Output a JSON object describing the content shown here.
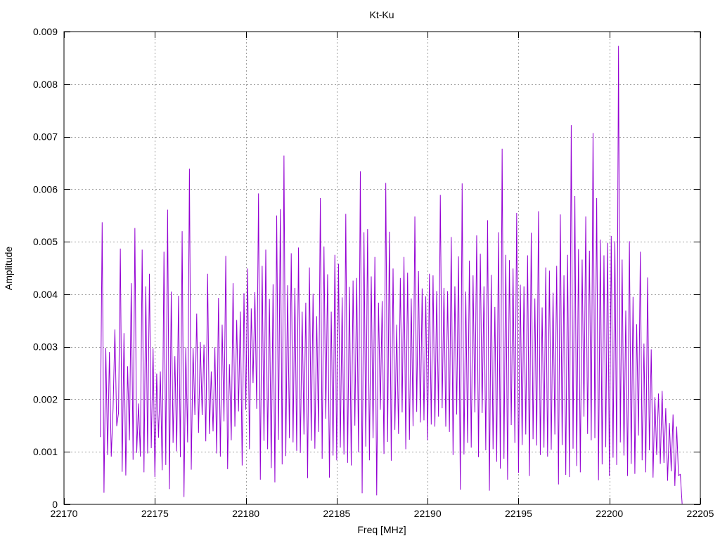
{
  "chart_data": {
    "type": "line",
    "title": "Kt-Ku",
    "xlabel": "Freq [MHz]",
    "ylabel": "Amplitude",
    "xlim": [
      22170,
      22205
    ],
    "ylim": [
      0,
      0.009
    ],
    "xticks": [
      22170,
      22175,
      22180,
      22185,
      22190,
      22195,
      22200,
      22205
    ],
    "xtick_labels": [
      "22170",
      "22175",
      "22180",
      "22185",
      "22190",
      "22195",
      "22200",
      "22205"
    ],
    "yticks": [
      0,
      0.001,
      0.002,
      0.003,
      0.004,
      0.005,
      0.006,
      0.007,
      0.008,
      0.009
    ],
    "ytick_labels": [
      "0",
      "0.001",
      "0.002",
      "0.003",
      "0.004",
      "0.005",
      "0.006",
      "0.007",
      "0.008",
      "0.009"
    ],
    "grid": true,
    "series": [
      {
        "color": "#9400d3",
        "x": [
          22172.0,
          22172.1,
          22172.2,
          22172.3,
          22172.4,
          22172.5,
          22172.6,
          22172.7,
          22172.8,
          22172.9,
          22173.0,
          22173.1,
          22173.2,
          22173.3,
          22173.4,
          22173.5,
          22173.6,
          22173.7,
          22173.8,
          22173.9,
          22174.0,
          22174.1,
          22174.2,
          22174.3,
          22174.4,
          22174.5,
          22174.6,
          22174.7,
          22174.8,
          22174.9,
          22175.0,
          22175.1,
          22175.2,
          22175.3,
          22175.4,
          22175.5,
          22175.6,
          22175.7,
          22175.8,
          22175.9,
          22176.0,
          22176.1,
          22176.2,
          22176.3,
          22176.4,
          22176.5,
          22176.6,
          22176.7,
          22176.8,
          22176.9,
          22177.0,
          22177.1,
          22177.2,
          22177.3,
          22177.4,
          22177.5,
          22177.6,
          22177.7,
          22177.8,
          22177.9,
          22178.0,
          22178.1,
          22178.2,
          22178.3,
          22178.4,
          22178.5,
          22178.6,
          22178.7,
          22178.8,
          22178.9,
          22179.0,
          22179.1,
          22179.2,
          22179.3,
          22179.4,
          22179.5,
          22179.6,
          22179.7,
          22179.8,
          22179.9,
          22180.0,
          22180.1,
          22180.2,
          22180.3,
          22180.4,
          22180.5,
          22180.6,
          22180.7,
          22180.8,
          22180.9,
          22181.0,
          22181.1,
          22181.2,
          22181.3,
          22181.4,
          22181.5,
          22181.6,
          22181.7,
          22181.8,
          22181.9,
          22182.0,
          22182.1,
          22182.2,
          22182.3,
          22182.4,
          22182.5,
          22182.6,
          22182.7,
          22182.8,
          22182.9,
          22183.0,
          22183.1,
          22183.2,
          22183.3,
          22183.4,
          22183.5,
          22183.6,
          22183.7,
          22183.8,
          22183.9,
          22184.0,
          22184.1,
          22184.2,
          22184.3,
          22184.4,
          22184.5,
          22184.6,
          22184.7,
          22184.8,
          22184.9,
          22185.0,
          22185.1,
          22185.2,
          22185.3,
          22185.4,
          22185.5,
          22185.6,
          22185.7,
          22185.8,
          22185.9,
          22186.0,
          22186.1,
          22186.2,
          22186.3,
          22186.4,
          22186.5,
          22186.6,
          22186.7,
          22186.8,
          22186.9,
          22187.0,
          22187.1,
          22187.2,
          22187.3,
          22187.4,
          22187.5,
          22187.6,
          22187.7,
          22187.8,
          22187.9,
          22188.0,
          22188.1,
          22188.2,
          22188.3,
          22188.4,
          22188.5,
          22188.6,
          22188.7,
          22188.8,
          22188.9,
          22189.0,
          22189.1,
          22189.2,
          22189.3,
          22189.4,
          22189.5,
          22189.6,
          22189.7,
          22189.8,
          22189.9,
          22190.0,
          22190.1,
          22190.2,
          22190.3,
          22190.4,
          22190.5,
          22190.6,
          22190.7,
          22190.8,
          22190.9,
          22191.0,
          22191.1,
          22191.2,
          22191.3,
          22191.4,
          22191.5,
          22191.6,
          22191.7,
          22191.8,
          22191.9,
          22192.0,
          22192.1,
          22192.2,
          22192.3,
          22192.4,
          22192.5,
          22192.6,
          22192.7,
          22192.8,
          22192.9,
          22193.0,
          22193.1,
          22193.2,
          22193.3,
          22193.4,
          22193.5,
          22193.6,
          22193.7,
          22193.8,
          22193.9,
          22194.0,
          22194.1,
          22194.2,
          22194.3,
          22194.4,
          22194.5,
          22194.6,
          22194.7,
          22194.8,
          22194.9,
          22195.0,
          22195.1,
          22195.2,
          22195.3,
          22195.4,
          22195.5,
          22195.6,
          22195.7,
          22195.8,
          22195.9,
          22196.0,
          22196.1,
          22196.2,
          22196.3,
          22196.4,
          22196.5,
          22196.6,
          22196.7,
          22196.8,
          22196.9,
          22197.0,
          22197.1,
          22197.2,
          22197.3,
          22197.4,
          22197.5,
          22197.6,
          22197.7,
          22197.8,
          22197.9,
          22198.0,
          22198.1,
          22198.2,
          22198.3,
          22198.4,
          22198.5,
          22198.6,
          22198.7,
          22198.8,
          22198.9,
          22199.0,
          22199.1,
          22199.2,
          22199.3,
          22199.4,
          22199.5,
          22199.6,
          22199.7,
          22199.8,
          22199.9,
          22200.0,
          22200.1,
          22200.2,
          22200.3,
          22200.4,
          22200.5,
          22200.6,
          22200.7,
          22200.8,
          22200.9,
          22201.0,
          22201.1,
          22201.2,
          22201.3,
          22201.4,
          22201.5,
          22201.6,
          22201.7,
          22201.8,
          22201.9,
          22202.0,
          22202.1,
          22202.2,
          22202.3,
          22202.4,
          22202.5,
          22202.6,
          22202.7,
          22202.8,
          22202.9,
          22203.0,
          22203.1,
          22203.2,
          22203.3,
          22203.4,
          22203.5,
          22203.6,
          22203.7,
          22203.8,
          22203.9,
          22204.0
        ],
        "y": [
          0.00128,
          0.00537,
          0.00022,
          0.00298,
          0.00094,
          0.0029,
          0.00091,
          0.00182,
          0.00333,
          0.00149,
          0.00174,
          0.00487,
          0.00062,
          0.00326,
          0.00055,
          0.00263,
          0.00122,
          0.00421,
          0.00085,
          0.00526,
          0.00098,
          0.00192,
          0.00091,
          0.00485,
          0.00061,
          0.00415,
          0.00097,
          0.00439,
          0.00107,
          0.00297,
          0.00052,
          0.00249,
          0.00127,
          0.00253,
          0.00065,
          0.00481,
          0.00075,
          0.00561,
          0.00029,
          0.00405,
          0.00117,
          0.00282,
          0.00101,
          0.00397,
          0.0009,
          0.0052,
          0.00014,
          0.00299,
          0.00118,
          0.00639,
          0.00066,
          0.00298,
          0.0017,
          0.00363,
          0.00136,
          0.00309,
          0.0017,
          0.00304,
          0.0012,
          0.00439,
          0.00134,
          0.00253,
          0.00139,
          0.00299,
          0.00097,
          0.00393,
          0.00091,
          0.00342,
          0.00158,
          0.00473,
          0.00067,
          0.00267,
          0.00122,
          0.00421,
          0.00148,
          0.00351,
          0.00177,
          0.00367,
          0.00074,
          0.00402,
          0.0018,
          0.00449,
          0.00105,
          0.00373,
          0.00231,
          0.00404,
          0.00182,
          0.00592,
          0.00047,
          0.00454,
          0.00121,
          0.00485,
          0.00105,
          0.00391,
          0.00069,
          0.00419,
          0.00042,
          0.0055,
          0.00123,
          0.00562,
          0.00076,
          0.00664,
          0.00092,
          0.00417,
          0.00126,
          0.00478,
          0.00118,
          0.00412,
          0.00102,
          0.00489,
          0.00098,
          0.00367,
          0.00133,
          0.00384,
          0.0005,
          0.00451,
          0.00121,
          0.00401,
          0.00106,
          0.00358,
          0.00138,
          0.00583,
          0.00087,
          0.00491,
          0.00163,
          0.00438,
          0.00051,
          0.00367,
          0.00093,
          0.00475,
          0.00084,
          0.00458,
          0.00108,
          0.00394,
          0.00095,
          0.00553,
          0.00079,
          0.00414,
          0.00074,
          0.00426,
          0.0015,
          0.00431,
          0.00099,
          0.00634,
          0.00021,
          0.00518,
          0.0011,
          0.00524,
          0.00084,
          0.00434,
          0.00126,
          0.00471,
          0.00017,
          0.00384,
          0.0018,
          0.00387,
          0.00096,
          0.00612,
          0.00119,
          0.00519,
          0.00083,
          0.00449,
          0.00142,
          0.00342,
          0.00134,
          0.00431,
          0.00175,
          0.00471,
          0.00105,
          0.00441,
          0.00123,
          0.00392,
          0.00149,
          0.00548,
          0.00176,
          0.00444,
          0.00156,
          0.00411,
          0.0016,
          0.00396,
          0.00122,
          0.00439,
          0.00152,
          0.00436,
          0.00148,
          0.00406,
          0.00167,
          0.00589,
          0.00183,
          0.00412,
          0.00148,
          0.00406,
          0.00138,
          0.00509,
          0.00094,
          0.00415,
          0.00171,
          0.00472,
          0.00028,
          0.00611,
          0.00095,
          0.00405,
          0.00117,
          0.00464,
          0.00108,
          0.00436,
          0.00175,
          0.00512,
          0.0009,
          0.00477,
          0.00174,
          0.00415,
          0.00103,
          0.00541,
          0.00026,
          0.00437,
          0.00105,
          0.00376,
          0.00081,
          0.00518,
          0.00068,
          0.00677,
          0.00087,
          0.00475,
          0.00047,
          0.00465,
          0.00151,
          0.00449,
          0.00117,
          0.00555,
          0.0006,
          0.00418,
          0.00113,
          0.00415,
          0.00133,
          0.00474,
          0.00054,
          0.00517,
          0.00124,
          0.00392,
          0.00112,
          0.00558,
          0.00094,
          0.00375,
          0.00108,
          0.00451,
          0.00091,
          0.00445,
          0.00104,
          0.00403,
          0.00133,
          0.00454,
          0.00038,
          0.00552,
          0.00113,
          0.00436,
          0.00056,
          0.00475,
          0.00052,
          0.00722,
          0.00106,
          0.00587,
          0.00073,
          0.00486,
          0.00061,
          0.00466,
          0.00167,
          0.00548,
          0.00134,
          0.00483,
          0.00122,
          0.00707,
          0.00126,
          0.00583,
          0.00046,
          0.00504,
          0.00076,
          0.00474,
          0.00109,
          0.00498,
          0.00054,
          0.00511,
          0.00089,
          0.00501,
          0.00075,
          0.00873,
          0.00118,
          0.00466,
          0.00093,
          0.00369,
          0.00054,
          0.00501,
          0.00077,
          0.00395,
          0.00058,
          0.00343,
          0.00131,
          0.00481,
          0.00084,
          0.00306,
          0.00061,
          0.00432,
          0.00103,
          0.00295,
          0.00051,
          0.00204,
          0.00094,
          0.00211,
          0.00077,
          0.00216,
          0.00079,
          0.00183,
          0.00045,
          0.00155,
          0.00063,
          0.00171,
          0.00035,
          0.00148,
          0.00055,
          0.00057,
          1e-05
        ]
      }
    ]
  }
}
